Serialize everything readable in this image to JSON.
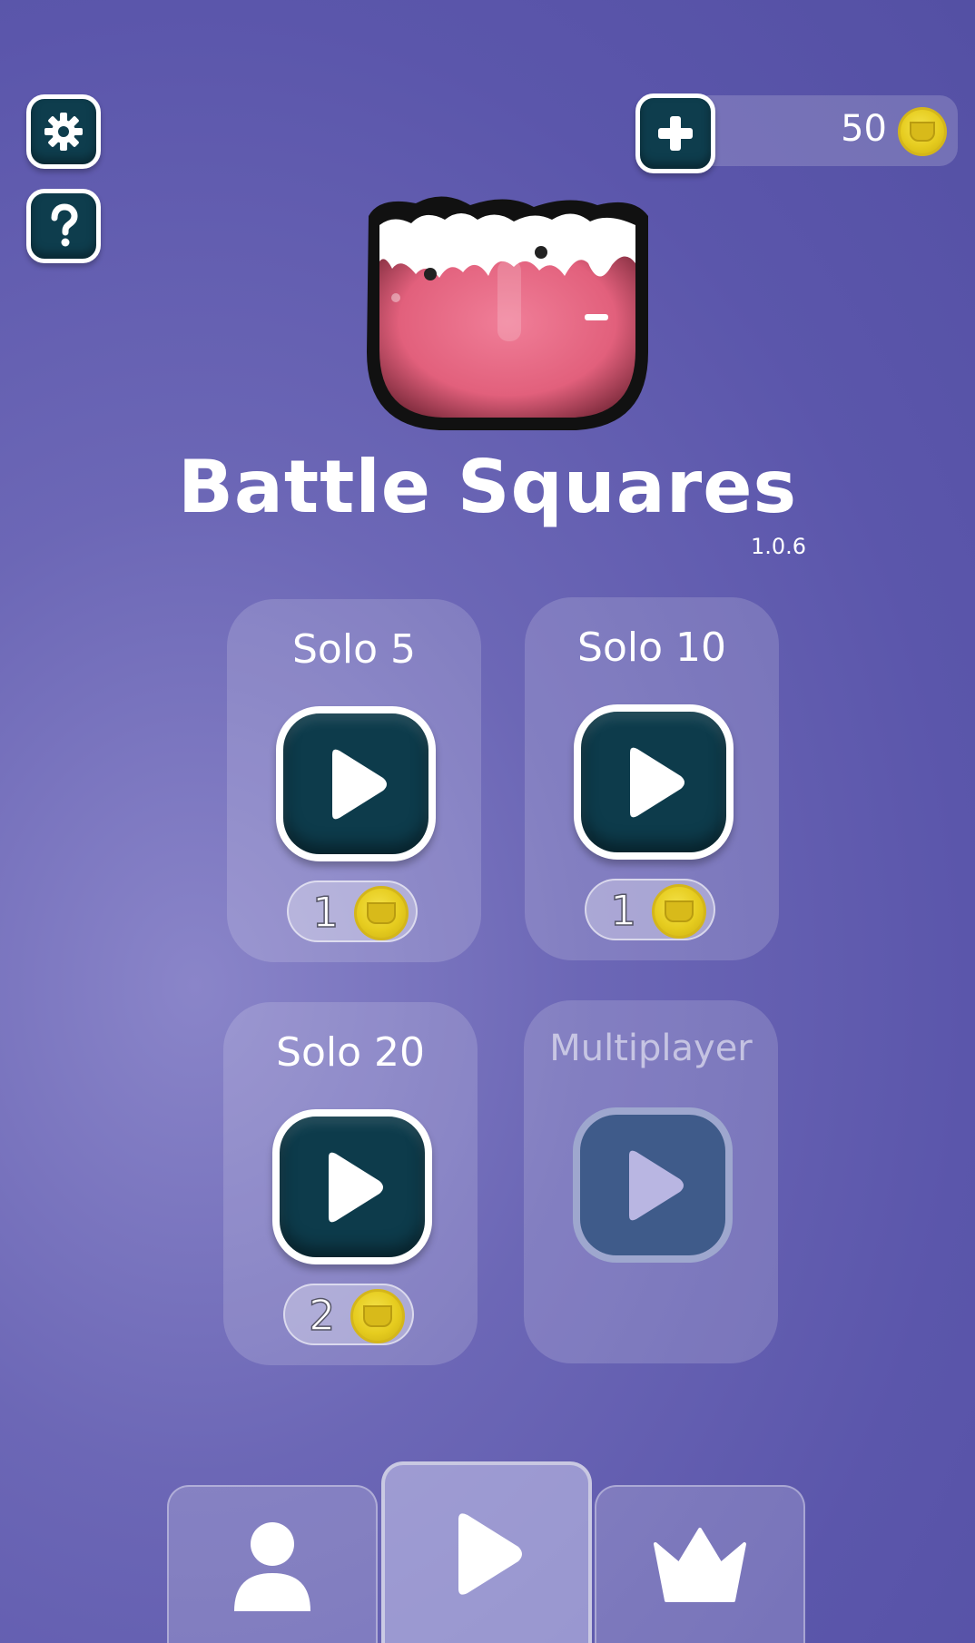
{
  "header": {
    "settings_icon": "gear-icon",
    "help_icon": "question-icon",
    "add_coins_icon": "plus-icon",
    "coin_balance": "50",
    "coin_icon": "crown-coin-icon"
  },
  "app": {
    "title": "Battle Squares",
    "version": "1.0.6"
  },
  "modes": [
    {
      "label": "Solo 5",
      "cost": "1",
      "enabled": true
    },
    {
      "label": "Solo 10",
      "cost": "1",
      "enabled": true
    },
    {
      "label": "Solo 20",
      "cost": "2",
      "enabled": true
    },
    {
      "label": "Multiplayer",
      "cost": "",
      "enabled": false
    }
  ],
  "bottom_nav": {
    "tabs": [
      {
        "icon": "person-icon",
        "active": false
      },
      {
        "icon": "play-icon",
        "active": true
      },
      {
        "icon": "crown-icon",
        "active": false
      }
    ]
  },
  "colors": {
    "background": "#5b56ab",
    "button_dark": "#0d3b4b",
    "logo_pink": "#e96a86",
    "coin_gold": "#e6cc1f"
  }
}
